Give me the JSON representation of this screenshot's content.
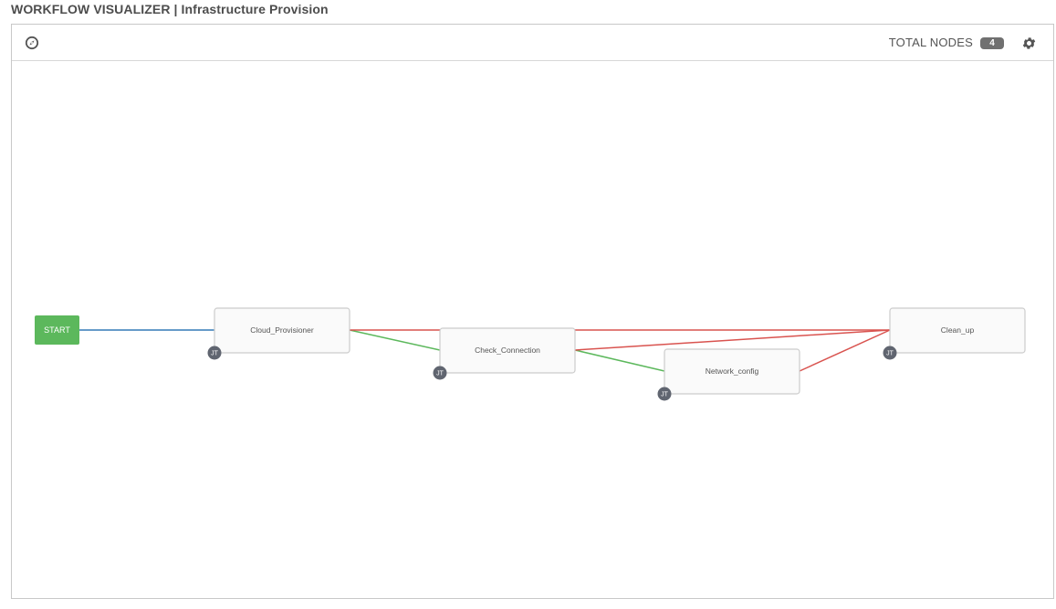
{
  "header": {
    "title": "WORKFLOW VISUALIZER | Infrastructure Provision"
  },
  "toolbar": {
    "total_nodes_label": "TOTAL NODES",
    "total_nodes_count": "4",
    "compass_icon": "compass-icon",
    "settings_icon": "gear-icon"
  },
  "colors": {
    "start": "#5cb85c",
    "always_link": "#337ab7",
    "success_link": "#5cb85c",
    "failure_link": "#d9534f",
    "node_border": "#cccccc",
    "node_fill": "#fafafa",
    "jt_badge": "#606570"
  },
  "workflow": {
    "start_label": "START",
    "nodes": [
      {
        "id": "cloud",
        "label": "Cloud_Provisioner",
        "type_badge": "JT"
      },
      {
        "id": "check",
        "label": "Check_Connection",
        "type_badge": "JT"
      },
      {
        "id": "network",
        "label": "Network_config",
        "type_badge": "JT"
      },
      {
        "id": "cleanup",
        "label": "Clean_up",
        "type_badge": "JT"
      }
    ],
    "links": [
      {
        "from": "start",
        "to": "cloud",
        "kind": "always"
      },
      {
        "from": "cloud",
        "to": "check",
        "kind": "success"
      },
      {
        "from": "cloud",
        "to": "cleanup",
        "kind": "failure"
      },
      {
        "from": "check",
        "to": "network",
        "kind": "success"
      },
      {
        "from": "check",
        "to": "cleanup",
        "kind": "failure"
      },
      {
        "from": "network",
        "to": "cleanup",
        "kind": "failure"
      }
    ]
  }
}
